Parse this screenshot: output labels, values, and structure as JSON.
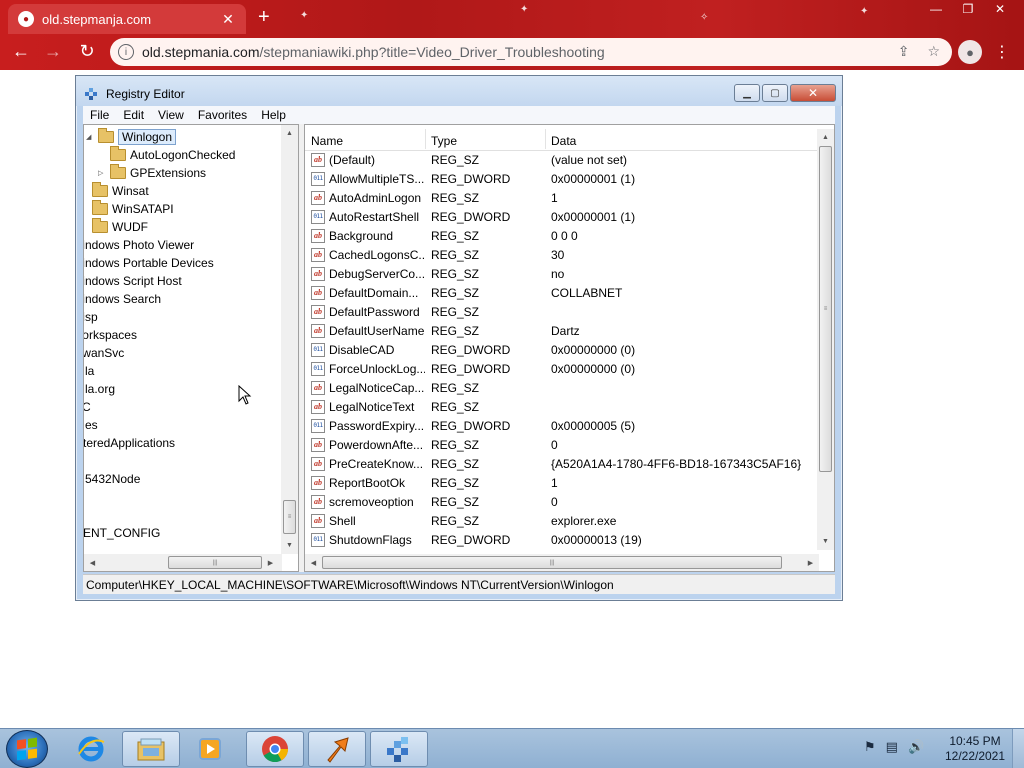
{
  "browser": {
    "tab_title": "old.stepmanja.com",
    "url_host": "old.stepmania.com",
    "url_path": "/stepmaniawiki.php?title=Video_Driver_Troubleshooting"
  },
  "regedit": {
    "title": "Registry Editor",
    "menu": [
      "File",
      "Edit",
      "View",
      "Favorites",
      "Help"
    ],
    "tree": [
      {
        "label": "Winlogon",
        "selected": true
      },
      {
        "label": "AutoLogonChecked"
      },
      {
        "label": "GPExtensions"
      },
      {
        "label": "Winsat"
      },
      {
        "label": "WinSATAPI"
      },
      {
        "label": "WUDF"
      },
      {
        "label": "'indows Photo Viewer"
      },
      {
        "label": "'indows Portable Devices"
      },
      {
        "label": "'indows Script Host"
      },
      {
        "label": "'indows Search"
      },
      {
        "label": "'isp"
      },
      {
        "label": "'orkspaces"
      },
      {
        "label": "'wanSvc"
      },
      {
        "label": "la"
      },
      {
        "label": "la.org"
      },
      {
        "label": "C"
      },
      {
        "label": "es"
      },
      {
        "label": "teredApplications"
      },
      {
        "label": ""
      },
      {
        "label": "5432Node"
      },
      {
        "label": ""
      },
      {
        "label": ""
      },
      {
        "label": "ENT_CONFIG"
      }
    ],
    "columns": {
      "name": "Name",
      "type": "Type",
      "data": "Data"
    },
    "values": [
      {
        "name": "(Default)",
        "type": "REG_SZ",
        "data": "(value not set)",
        "kind": "sz"
      },
      {
        "name": "AllowMultipleTS...",
        "type": "REG_DWORD",
        "data": "0x00000001 (1)",
        "kind": "dword"
      },
      {
        "name": "AutoAdminLogon",
        "type": "REG_SZ",
        "data": "1",
        "kind": "sz"
      },
      {
        "name": "AutoRestartShell",
        "type": "REG_DWORD",
        "data": "0x00000001 (1)",
        "kind": "dword"
      },
      {
        "name": "Background",
        "type": "REG_SZ",
        "data": "0 0 0",
        "kind": "sz"
      },
      {
        "name": "CachedLogonsC...",
        "type": "REG_SZ",
        "data": "30",
        "kind": "sz"
      },
      {
        "name": "DebugServerCo...",
        "type": "REG_SZ",
        "data": "no",
        "kind": "sz"
      },
      {
        "name": "DefaultDomain...",
        "type": "REG_SZ",
        "data": "COLLABNET",
        "kind": "sz"
      },
      {
        "name": "DefaultPassword",
        "type": "REG_SZ",
        "data": "",
        "kind": "sz"
      },
      {
        "name": "DefaultUserName",
        "type": "REG_SZ",
        "data": "Dartz",
        "kind": "sz"
      },
      {
        "name": "DisableCAD",
        "type": "REG_DWORD",
        "data": "0x00000000 (0)",
        "kind": "dword"
      },
      {
        "name": "ForceUnlockLog...",
        "type": "REG_DWORD",
        "data": "0x00000000 (0)",
        "kind": "dword"
      },
      {
        "name": "LegalNoticeCap...",
        "type": "REG_SZ",
        "data": "",
        "kind": "sz"
      },
      {
        "name": "LegalNoticeText",
        "type": "REG_SZ",
        "data": "",
        "kind": "sz"
      },
      {
        "name": "PasswordExpiry...",
        "type": "REG_DWORD",
        "data": "0x00000005 (5)",
        "kind": "dword"
      },
      {
        "name": "PowerdownAfte...",
        "type": "REG_SZ",
        "data": "0",
        "kind": "sz"
      },
      {
        "name": "PreCreateKnow...",
        "type": "REG_SZ",
        "data": "{A520A1A4-1780-4FF6-BD18-167343C5AF16}",
        "kind": "sz"
      },
      {
        "name": "ReportBootOk",
        "type": "REG_SZ",
        "data": "1",
        "kind": "sz"
      },
      {
        "name": "scremoveoption",
        "type": "REG_SZ",
        "data": "0",
        "kind": "sz"
      },
      {
        "name": "Shell",
        "type": "REG_SZ",
        "data": "explorer.exe",
        "kind": "sz"
      },
      {
        "name": "ShutdownFlags",
        "type": "REG_DWORD",
        "data": "0x00000013 (19)",
        "kind": "dword"
      }
    ],
    "status_path": "Computer\\HKEY_LOCAL_MACHINE\\SOFTWARE\\Microsoft\\Windows NT\\CurrentVersion\\Winlogon"
  },
  "taskbar": {
    "time": "10:45 PM",
    "date": "12/22/2021",
    "apps": [
      "internet-explorer",
      "windows-explorer",
      "media-player",
      "chrome",
      "reporting-app",
      "registry-editor"
    ]
  },
  "colors": {
    "chrome_accent": "#c81e1e",
    "selection": "#ddecfc",
    "window_frame": "#bcd3ee",
    "taskbar": "#a9c3dd"
  }
}
